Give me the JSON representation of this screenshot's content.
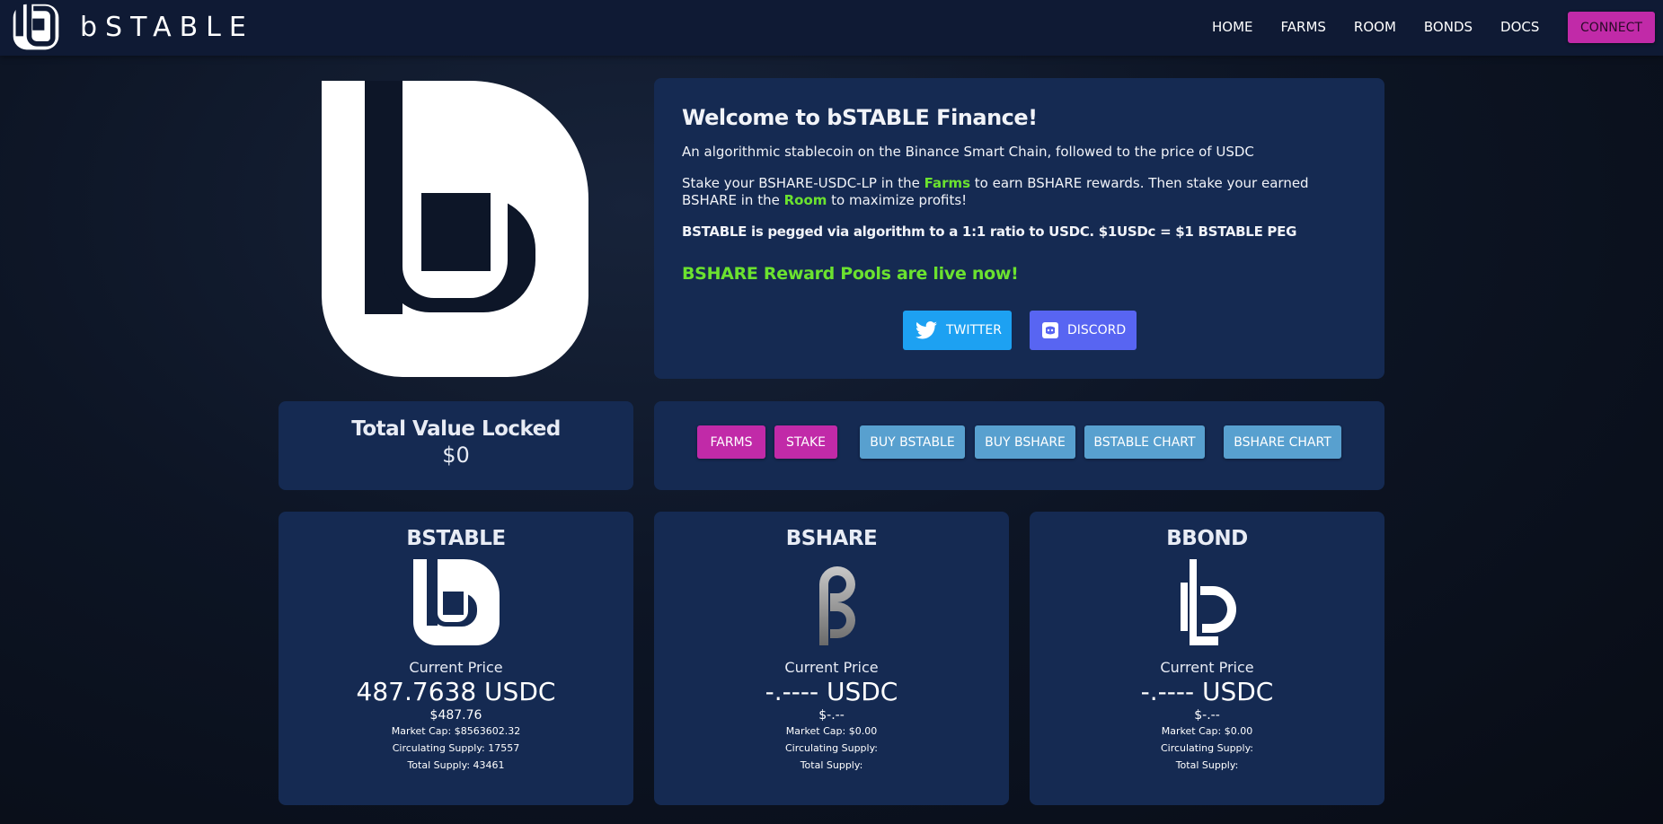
{
  "app": {
    "brand_name": "bSTABLE"
  },
  "nav": {
    "items": [
      "HOME",
      "FARMS",
      "ROOM",
      "BONDS",
      "DOCS"
    ],
    "connect_label": "CONNECT"
  },
  "welcome": {
    "title": "Welcome to bSTABLE Finance!",
    "intro": "An algorithmic stablecoin on the Binance Smart Chain, followed to the price of USDC",
    "stake_pre": "Stake your BSHARE-USDC-LP in the ",
    "farms_link": "Farms",
    "stake_mid": " to earn BSHARE rewards. Then stake your earned BSHARE in the ",
    "room_link": "Room",
    "stake_post": " to maximize profits!",
    "peg_text": "BSTABLE is pegged via algorithm to a 1:1 ratio to USDC. $1USDc = $1 BSTABLE PEG",
    "live_text": "BSHARE Reward Pools are live now!",
    "twitter_label": "TWITTER",
    "discord_label": "DISCORD"
  },
  "tvl": {
    "label": "Total Value Locked",
    "value": "$0"
  },
  "actions": {
    "farms": "FARMS",
    "stake": "STAKE",
    "buy_bstable": "BUY BSTABLE",
    "buy_bshare": "BUY BSHARE",
    "bstable_chart": "BSTABLE CHART",
    "bshare_chart": "BSHARE CHART"
  },
  "tokens": [
    {
      "name": "BSTABLE",
      "icon": "bstable-logo-icon",
      "current_price_label": "Current Price",
      "price": "487.7638 USDC",
      "usd_price": "$487.76",
      "market_cap": "Market Cap: $8563602.32",
      "circulating_supply": "Circulating Supply: 17557",
      "total_supply": "Total Supply: 43461"
    },
    {
      "name": "BSHARE",
      "icon": "bshare-logo-icon",
      "current_price_label": "Current Price",
      "price": "-.---- USDC",
      "usd_price": "$-.--",
      "market_cap": "Market Cap: $0.00",
      "circulating_supply": "Circulating Supply:",
      "total_supply": "Total Supply:"
    },
    {
      "name": "BBOND",
      "icon": "bbond-logo-icon",
      "current_price_label": "Current Price",
      "price": "-.---- USDC",
      "usd_price": "$-.--",
      "market_cap": "Market Cap: $0.00",
      "circulating_supply": "Circulating Supply:",
      "total_supply": "Total Supply:"
    }
  ],
  "colors": {
    "panel": "#152a52",
    "topbar": "#0f1a34",
    "accent_pink": "#c12aa8",
    "accent_blue": "#58a0cf",
    "green": "#6be22f",
    "twitter": "#1da1f2",
    "discord": "#5865f2"
  }
}
